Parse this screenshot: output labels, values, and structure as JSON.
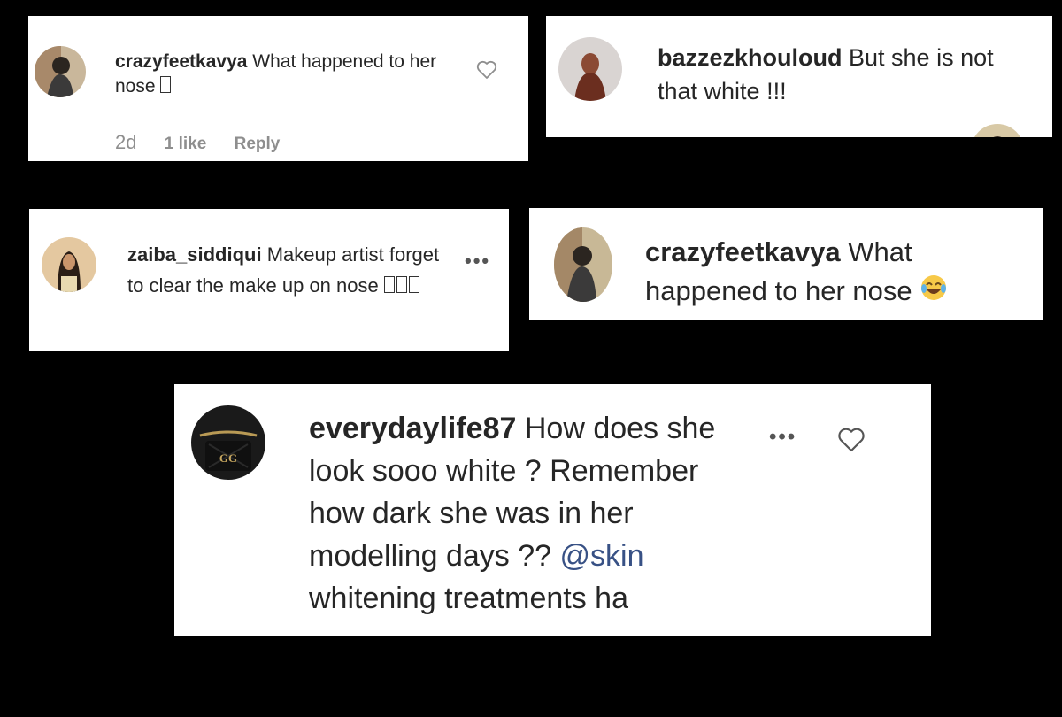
{
  "comments": [
    {
      "username": "crazyfeetkavya",
      "text": "What happened to her nose",
      "emoji": "□",
      "time": "2d",
      "likes": "1 like",
      "reply": "Reply"
    },
    {
      "username": "bazzezkhouloud",
      "text": "But she is not that white !!!"
    },
    {
      "username": "zaiba_siddiqui",
      "text": "Makeup artist forget to clear the make up on nose",
      "emoji": "□□□"
    },
    {
      "username": "crazyfeetkavya",
      "text": "What happened to her nose",
      "emoji_name": "face-with-tears-of-joy"
    },
    {
      "username": "everydaylife87",
      "text_before": "How does she look sooo white ? Remember how dark she was in her modelling days ??",
      "mention": "@skin",
      "text_after": "whitening treatments ha"
    }
  ],
  "icons": {
    "heart": "heart-icon",
    "more": "more-options-icon"
  },
  "colors": {
    "background": "#000000",
    "card": "#ffffff",
    "text": "#262626",
    "meta": "#8e8e8e",
    "mention": "#385185"
  }
}
